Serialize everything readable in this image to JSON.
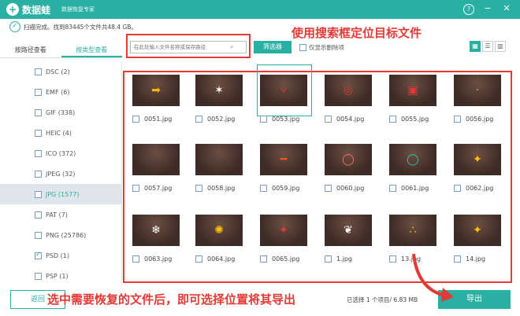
{
  "app": {
    "name": "数据蛙",
    "subtitle": "数据恢复专家"
  },
  "window_buttons": [
    "?",
    "−",
    "✕"
  ],
  "status": {
    "text": "扫描完成。找到83445个文件共48.4 GB。"
  },
  "tabs": [
    {
      "label": "按路径查看",
      "active": false
    },
    {
      "label": "按类型查看",
      "active": true
    }
  ],
  "sidebar": {
    "items": [
      {
        "label": "DSC (2)",
        "checked": false,
        "selected": false
      },
      {
        "label": "EMF (6)",
        "checked": false,
        "selected": false
      },
      {
        "label": "GIF (338)",
        "checked": false,
        "selected": false
      },
      {
        "label": "HEIC (4)",
        "checked": false,
        "selected": false
      },
      {
        "label": "ICO (372)",
        "checked": false,
        "selected": false
      },
      {
        "label": "JPEG (32)",
        "checked": false,
        "selected": false
      },
      {
        "label": "JPG (1577)",
        "checked": false,
        "selected": true
      },
      {
        "label": "PAT (7)",
        "checked": false,
        "selected": false
      },
      {
        "label": "PNG (25786)",
        "checked": false,
        "selected": false
      },
      {
        "label": "PSD (1)",
        "checked": true,
        "selected": false
      },
      {
        "label": "PSP (1)",
        "checked": false,
        "selected": false
      }
    ]
  },
  "search": {
    "placeholder": "在此处输入文件名称或保存路径"
  },
  "filter_label": "筛选器",
  "deleted_only_label": "仅显示删除项",
  "annotation_top": "使用搜索框定位目标文件",
  "annotation_bottom": "选中需要恢复的文件后，即可选择位置将其导出",
  "files": [
    {
      "name": "0051.jpg",
      "glyph": "➡",
      "color": "#f5b800"
    },
    {
      "name": "0052.jpg",
      "glyph": "✶",
      "color": "#ffffff"
    },
    {
      "name": "0053.jpg",
      "glyph": "✧",
      "color": "#e53935"
    },
    {
      "name": "0054.jpg",
      "glyph": "◎",
      "color": "#e53935"
    },
    {
      "name": "0055.jpg",
      "glyph": "▣",
      "color": "#e53935"
    },
    {
      "name": "0056.jpg",
      "glyph": "·",
      "color": "#d8b06b"
    },
    {
      "name": "0057.jpg",
      "glyph": "",
      "color": "#ffffff"
    },
    {
      "name": "0058.jpg",
      "glyph": "",
      "color": "#ffffff"
    },
    {
      "name": "0059.jpg",
      "glyph": "━",
      "color": "#ff5722"
    },
    {
      "name": "0060.jpg",
      "glyph": "◯",
      "color": "#ff6b6b"
    },
    {
      "name": "0061.jpg",
      "glyph": "◯",
      "color": "#26c6a6"
    },
    {
      "name": "0062.jpg",
      "glyph": "✦",
      "color": "#ffc107"
    },
    {
      "name": "0063.jpg",
      "glyph": "❄",
      "color": "#ffffff"
    },
    {
      "name": "0064.jpg",
      "glyph": "✺",
      "color": "#ffc107"
    },
    {
      "name": "0065.jpg",
      "glyph": "✦",
      "color": "#e53935"
    },
    {
      "name": "1.jpg",
      "glyph": "❦",
      "color": "#ffffff"
    },
    {
      "name": "13.jpg",
      "glyph": "∴",
      "color": "#ffc107"
    },
    {
      "name": "14.jpg",
      "glyph": "✦",
      "color": "#ffc107"
    }
  ],
  "selected_info": "已选择 1 个项目/ 6.83 MB",
  "back_label": "返回",
  "export_label": "导出",
  "view_modes": [
    "▦",
    "☰",
    "▥"
  ]
}
